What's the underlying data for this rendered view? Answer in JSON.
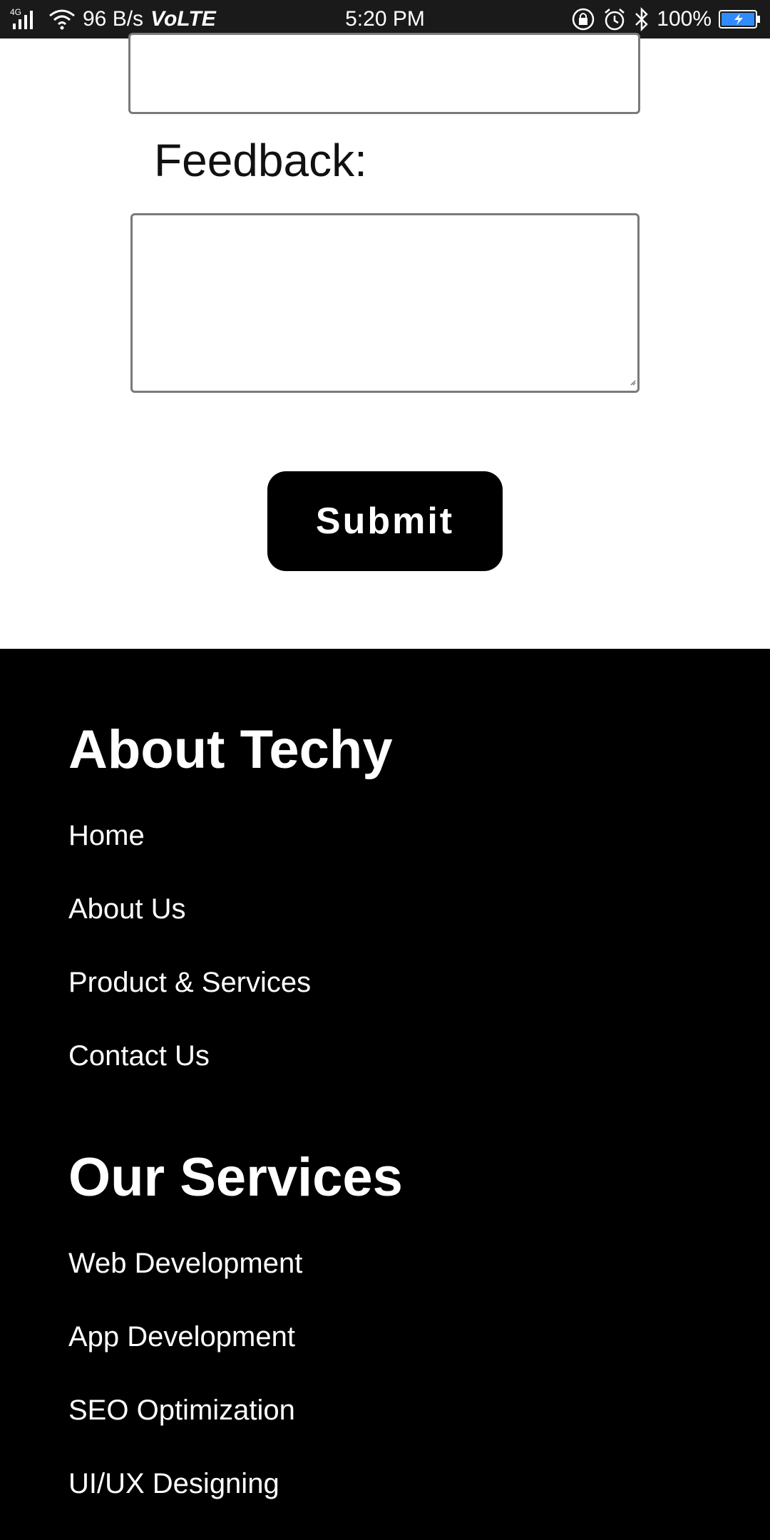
{
  "status_bar": {
    "network": "4G",
    "speed": "96 B/s",
    "volte": "VoLTE",
    "time": "5:20 PM",
    "battery": "100%"
  },
  "form": {
    "feedback_label": "Feedback:",
    "feedback_value": "",
    "submit_label": "Submit"
  },
  "footer": {
    "about_title": "About Techy",
    "about_links": [
      "Home",
      "About Us",
      "Product & Services",
      "Contact Us"
    ],
    "services_title": "Our Services",
    "services_links": [
      "Web Development",
      "App Development",
      "SEO Optimization",
      "UI/UX Designing"
    ]
  },
  "colors": {
    "footer_bg": "#000000",
    "button_bg": "#000000",
    "status_bar_bg": "#1a1a1a"
  }
}
